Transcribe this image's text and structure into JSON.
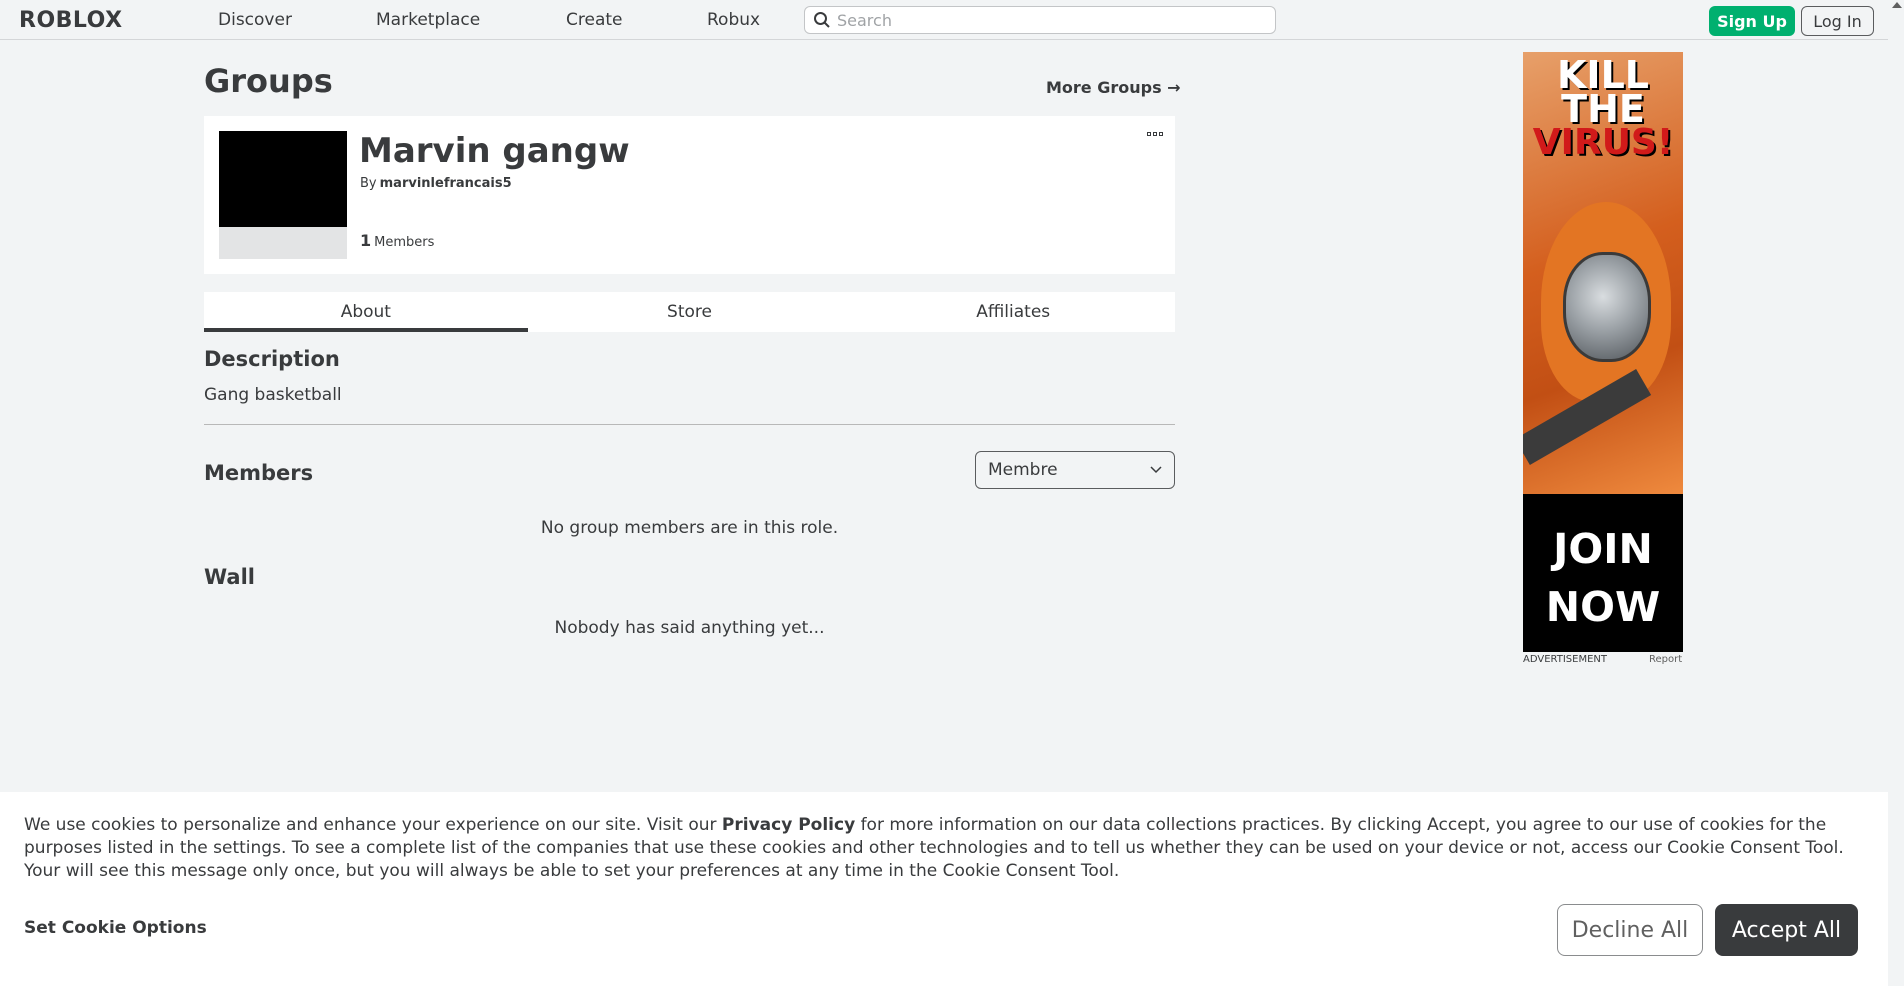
{
  "nav": {
    "logo": "ROBLOX",
    "links": [
      "Discover",
      "Marketplace",
      "Create",
      "Robux"
    ],
    "search_placeholder": "Search",
    "signup": "Sign Up",
    "login": "Log In"
  },
  "page": {
    "title": "Groups",
    "more_groups": "More Groups →"
  },
  "group": {
    "name": "Marvin gangw",
    "by_label": "By",
    "owner": "marvinlefrancais5",
    "member_count": "1",
    "members_label": "Members"
  },
  "tabs": [
    "About",
    "Store",
    "Affiliates"
  ],
  "about": {
    "description_title": "Description",
    "description": "Gang basketball",
    "members_title": "Members",
    "role_selected": "Membre",
    "no_members": "No group members are in this role.",
    "wall_title": "Wall",
    "wall_empty": "Nobody has said anything yet..."
  },
  "ad": {
    "line1": "KILL",
    "line2": "THE",
    "line3": "VIRUS!",
    "cta1": "JOIN",
    "cta2": "NOW",
    "label": "ADVERTISEMENT",
    "report": "Report"
  },
  "cookie": {
    "text_before": "We use cookies to personalize and enhance your experience on our site. Visit our ",
    "privacy_link": "Privacy Policy",
    "text_after": " for more information on our data collections practices. By clicking Accept, you agree to our use of cookies for the purposes listed in the settings. To see a complete list of the companies that use these cookies and other technologies and to tell us whether they can be used on your device or not, access our Cookie Consent Tool. Your will see this message only once, but you will always be able to set your preferences at any time in the Cookie Consent Tool.",
    "options": "Set Cookie Options",
    "decline": "Decline All",
    "accept": "Accept All"
  },
  "colors": {
    "brand_green": "#00b06f",
    "text": "#393b3d",
    "background": "#f2f4f5"
  }
}
